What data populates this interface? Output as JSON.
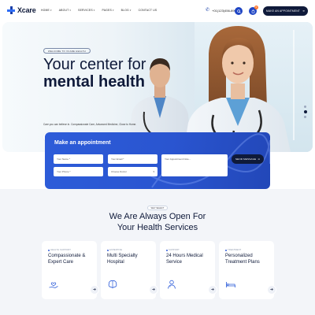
{
  "brand": {
    "name": "Xcare"
  },
  "nav": {
    "items": [
      {
        "label": "HOME"
      },
      {
        "label": "ABOUT"
      },
      {
        "label": "SERVICES"
      },
      {
        "label": "PAGES"
      },
      {
        "label": "BLOG"
      },
      {
        "label": "CONTACT US"
      }
    ]
  },
  "header": {
    "phone": "+01(123)456-890",
    "cart_count": "0",
    "cta_label": "MAKE AN APPOINTMENT"
  },
  "hero": {
    "tag": "WELCOME TO XCARE HEALTH",
    "title_line1": "Your center for",
    "title_line2": "mental health",
    "description": "Care you can believe in. Compassionate Care, Advanced Medicine, Close to Home.",
    "contact_label": "CONTACT US"
  },
  "appointment": {
    "title": "Make an appointment",
    "fields": {
      "first_name": "Your Name *",
      "email": "Your Email *",
      "phone": "Your Phone *",
      "doctor": "Choose Doctor",
      "date": "Your Appointment Date",
      "message": "Your Appointment Note..."
    },
    "submit_label": "SEND MESSAGE"
  },
  "services": {
    "badge": "WHY SELECT",
    "title_line1": "We Are Always Open For",
    "title_line2": "Your Health Services",
    "cards": [
      {
        "tag": "HEALTH SUPPORT",
        "title1": "Compassionate &",
        "title2": "Expert Care",
        "icon": "hand-heart-icon"
      },
      {
        "tag": "EXPERTISE",
        "title1": "Multi Specialty",
        "title2": "Hospital",
        "icon": "brain-icon"
      },
      {
        "tag": "SUPPORT",
        "title1": "24 Hours Medical",
        "title2": "Service",
        "icon": "doctor-icon"
      },
      {
        "tag": "TREATMENT",
        "title1": "Personalized",
        "title2": "Treatment Plans",
        "icon": "bed-icon"
      }
    ]
  },
  "colors": {
    "primary": "#2d5cd9",
    "dark": "#0f1a3a",
    "accent": "#ff7a30"
  }
}
